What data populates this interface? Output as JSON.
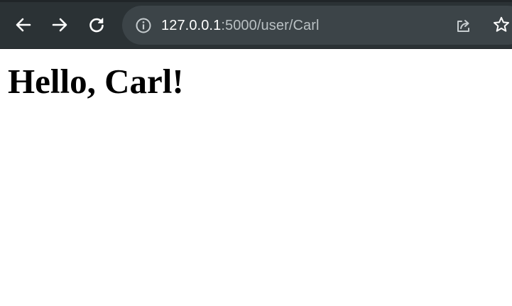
{
  "browser": {
    "url_host": "127.0.0.1",
    "url_rest": ":5000/user/Carl",
    "theme_colors": {
      "toolbar": "#2b3235",
      "omnibox": "#3c4448",
      "icon": "#ffffff"
    },
    "icons": {
      "back": "back-arrow-icon",
      "forward": "forward-arrow-icon",
      "reload": "reload-icon",
      "site_info": "info-icon",
      "share": "share-icon",
      "bookmark": "star-icon"
    }
  },
  "page": {
    "heading": "Hello, Carl!"
  }
}
